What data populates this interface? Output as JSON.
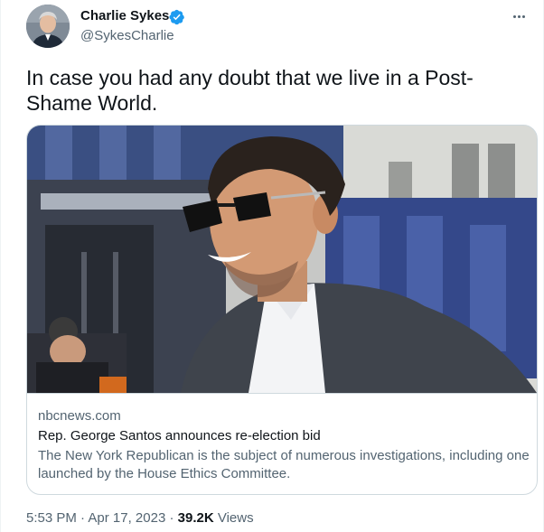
{
  "author": {
    "name": "Charlie Sykes",
    "handle": "@SykesCharlie",
    "verified": true,
    "verified_color": "#1d9bf0"
  },
  "tweet": {
    "text": "In case you had any doubt that we live in a Post-Shame World."
  },
  "card": {
    "domain": "nbcnews.com",
    "title": "Rep. George Santos announces re-election bid",
    "description": "The New York Republican is the subject of numerous investigations, including one launched by the House Ethics Committee."
  },
  "meta": {
    "time": "5:53 PM",
    "separator": " · ",
    "date": "Apr 17, 2023",
    "views_count": "39.2K",
    "views_label": " Views"
  },
  "icons": {
    "more": "more-horizontal-icon",
    "verified": "verified-badge-icon"
  }
}
